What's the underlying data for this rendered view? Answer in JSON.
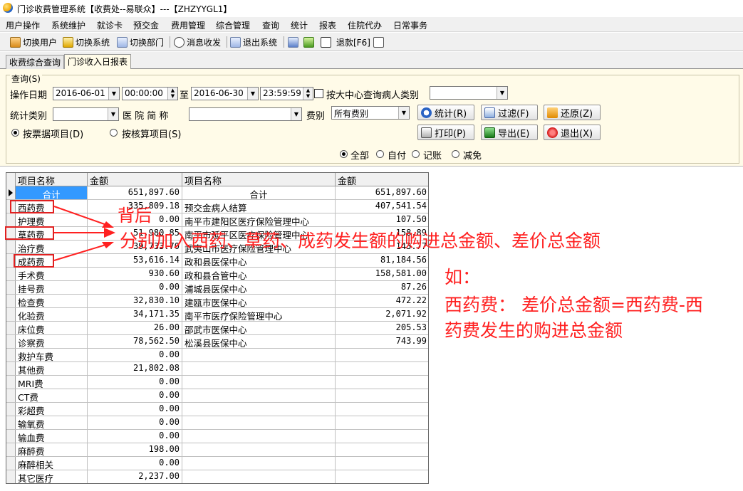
{
  "window": {
    "title": "门诊收费管理系统【收费处--易联众】---【ZHZYYGL1】"
  },
  "menu": [
    "用户操作",
    "系统维护",
    "就诊卡",
    "预交金",
    "费用管理",
    "综合管理",
    "查询",
    "统计",
    "报表",
    "住院代办",
    "日常事务"
  ],
  "toolbar": {
    "switch_user": "切换用户",
    "switch_system": "切换系统",
    "switch_dept": "切换部门",
    "messages": "消息收发",
    "exit_system": "退出系统",
    "refund": "退款[F6]"
  },
  "tabs": [
    "收费综合查询",
    "门诊收入日报表"
  ],
  "query": {
    "group_title": "查询(S)",
    "op_date_label": "操作日期",
    "date_from": "2016-06-01",
    "time_from": "00:00:00",
    "to_label": "至",
    "date_to": "2016-06-30",
    "time_to": "23:59:59",
    "center_query_label": "按大中心查询病人类别",
    "stat_category_label": "统计类别",
    "hospital_label": "医 院 简 称",
    "fee_type_label": "费别",
    "fee_type_value": "所有费别",
    "radio_invoice": "按票据项目(D)",
    "radio_accounting": "按核算项目(S)",
    "filter_all": "全部",
    "filter_self": "自付",
    "filter_charge": "记账",
    "filter_waive": "减免"
  },
  "buttons": {
    "stats": "统计(R)",
    "filter": "过滤(F)",
    "restore": "还原(Z)",
    "print": "打印(P)",
    "export": "导出(E)",
    "exit": "退出(X)"
  },
  "grid": {
    "headers": [
      "项目名称",
      "金额",
      "项目名称",
      "金额"
    ],
    "rows": [
      [
        "合计",
        "651,897.60",
        "合计",
        "651,897.60"
      ],
      [
        "西药费",
        "335,809.18",
        "预交金病人结算",
        "407,541.54"
      ],
      [
        "护理费",
        "0.00",
        "南平市建阳区医疗保险管理中心",
        "107.50"
      ],
      [
        "草药费",
        "51,980.85",
        "南平市延平区医疗保险管理中心",
        "158.89"
      ],
      [
        "治疗费",
        "39,733.70",
        "武夷山市医疗保险管理中心",
        "143.77"
      ],
      [
        "成药费",
        "53,616.14",
        "政和县医保中心",
        "81,184.56"
      ],
      [
        "手术费",
        "930.60",
        "政和县合管中心",
        "158,581.00"
      ],
      [
        "挂号费",
        "0.00",
        "浦城县医保中心",
        "87.26"
      ],
      [
        "检查费",
        "32,830.10",
        "建瓯市医保中心",
        "472.22"
      ],
      [
        "化验费",
        "34,171.35",
        "南平市医疗保险管理中心",
        "2,071.92"
      ],
      [
        "床位费",
        "26.00",
        "邵武市医保中心",
        "205.53"
      ],
      [
        "诊察费",
        "78,562.50",
        "松溪县医保中心",
        "743.99"
      ],
      [
        "救护车费",
        "0.00",
        "",
        ""
      ],
      [
        "其他费",
        "21,802.08",
        "",
        ""
      ],
      [
        "MRI费",
        "0.00",
        "",
        ""
      ],
      [
        "CT费",
        "0.00",
        "",
        ""
      ],
      [
        "彩超费",
        "0.00",
        "",
        ""
      ],
      [
        "输氧费",
        "0.00",
        "",
        ""
      ],
      [
        "输血费",
        "0.00",
        "",
        ""
      ],
      [
        "麻醉费",
        "198.00",
        "",
        ""
      ],
      [
        "麻醉相关",
        "0.00",
        "",
        ""
      ],
      [
        "其它医疗",
        "2,237.00",
        "",
        ""
      ]
    ]
  },
  "annotations": {
    "line1": "背后",
    "line2": "分别加入西药、草药、成药发生额的购进总金额、差价总金额",
    "line3": "如：",
    "line4": "西药费： 差价总金额=西药费-西",
    "line5": "药费发生的购进总金额",
    "color": "#ff2020"
  }
}
